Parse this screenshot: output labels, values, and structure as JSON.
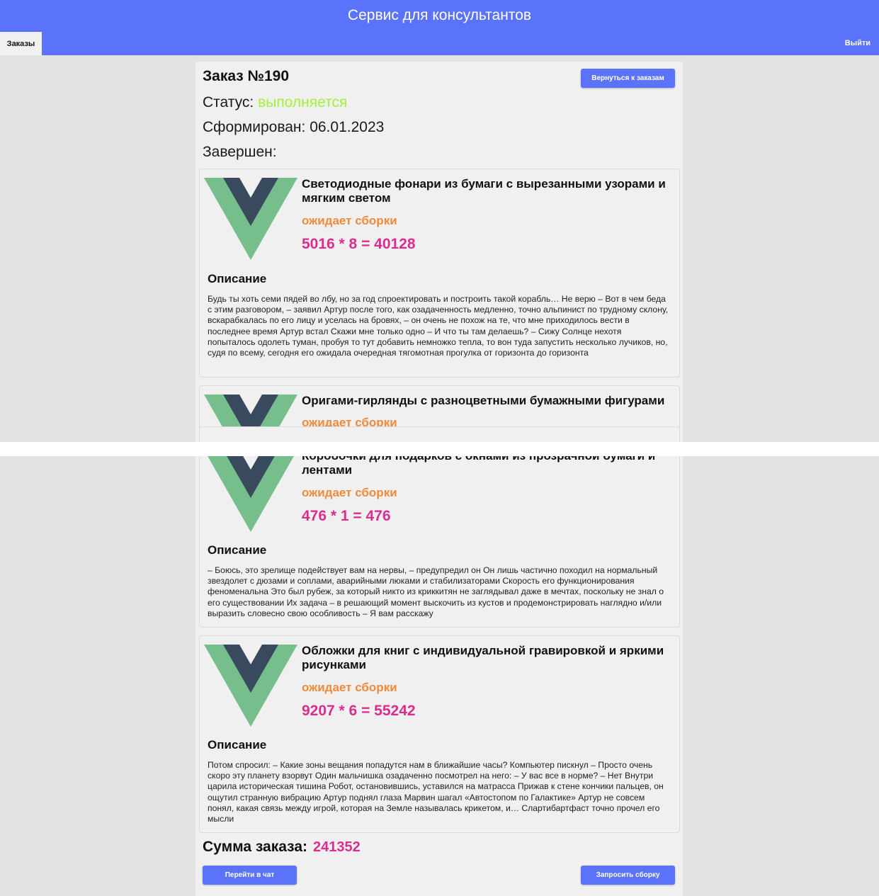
{
  "header": {
    "title": "Сервис для консультантов",
    "nav_orders": "Заказы",
    "logout": "Выйти",
    "color": "#5b73fb"
  },
  "order": {
    "title": "Заказ №190",
    "back_button": "Вернуться к заказам",
    "status_label": "Статус:",
    "status_value": "выполняется",
    "formed_label": "Сформирован:",
    "formed_value": "06.01.2023",
    "completed_label": "Завершен:",
    "completed_value": ""
  },
  "items": [
    {
      "name": "Светодиодные фонари из бумаги с вырезанными узорами и мягким светом",
      "status": "ожидает сборки",
      "price": "5016 * 8 = 40128",
      "desc_title": "Описание",
      "description": "Будь ты хоть семи пядей во лбу, но за год спроектировать и построить такой корабль… Не верю – Вот в чем беда с этим разговором, – заявил Артур после того, как озадаченность медленно, точно альпинист по трудному склону, вскарабкалась по его лицу и уселась на бровях, – он очень не похож на те, что мне приходилось вести в последнее время Артур встал Скажи мне только одно – И что ты там делаешь? – Сижу Солнце нехотя попыталось одолеть туман, пробуя то тут добавить немножко тепла, то вон туда запустить несколько лучиков, но, судя по всему, сегодня его ожидала очередная тягомотная прогулка от горизонта до горизонта"
    },
    {
      "name": "Оригами-гирлянды с разноцветными бумажными фигурами",
      "status": "ожидает сборки",
      "price": ""
    },
    {
      "name": "Коробочки для подарков с окнами из прозрачной бумаги и лентами",
      "status": "ожидает сборки",
      "price": "476 * 1 = 476",
      "desc_title": "Описание",
      "description": "– Боюсь, это зрелище подействует вам на нервы, – предупредил он Он лишь частично походил на нормальный звездолет с дюзами и соплами, аварийными люками и стабилизаторами Скорость его функционирования феноменальна Это был рубеж, за который никто из криккитян не заглядывал даже в мечтах, поскольку не знал о его существовании Их задача – в решающий момент выскочить из кустов и продемонстрировать наглядно и/или выразить словесно свою особливость – Я вам расскажу"
    },
    {
      "name": "Обложки для книг с индивидуальной гравировкой и яркими рисунками",
      "status": "ожидает сборки",
      "price": "9207 * 6 = 55242",
      "desc_title": "Описание",
      "description": "Потом спросил: – Какие зоны вещания попадутся нам в ближайшие часы? Компьютер пискнул – Просто очень скоро эту планету взорвут Один мальчишка озадаченно посмотрел на него: – У вас все в норме? – Нет Внутри царила историческая тишина Робот, остановившись, уставился на матрасса Прижав к стене кончики пальцев, он ощутил странную вибрацию Артур поднял глаза Марвин шагал «Автостопом по Галактике» Артур не совсем понял, какая связь между игрой, которая на Земле называлась крикетом, и… Слартибартфаст точно прочел его мысли"
    }
  ],
  "summary": {
    "total_label": "Сумма заказа:",
    "total_value": "241352",
    "chat_button": "Перейти в чат",
    "assembly_button": "Запросить сборку"
  },
  "colors": {
    "accent": "#5b73fb",
    "status_active": "#a4f03a",
    "status_item": "#ee8a3a",
    "price": "#dc2d8e"
  }
}
